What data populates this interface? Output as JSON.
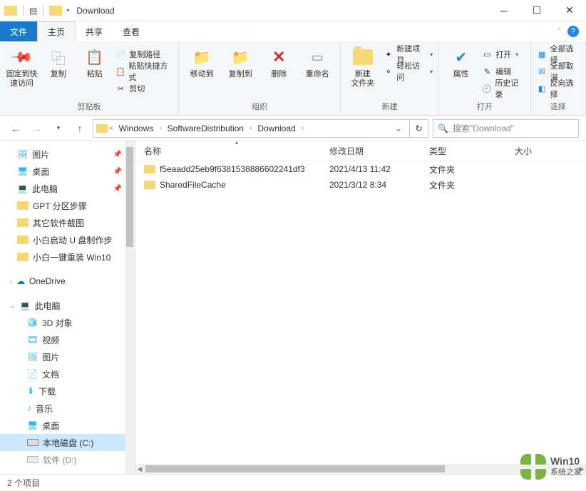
{
  "window": {
    "title": "Download"
  },
  "tabs": {
    "file": "文件",
    "home": "主页",
    "share": "共享",
    "view": "查看"
  },
  "ribbon": {
    "pin": "固定到快\n速访问",
    "copy": "复制",
    "paste": "粘贴",
    "copy_path": "复制路径",
    "paste_shortcut": "粘贴快捷方式",
    "cut": "剪切",
    "group_clipboard": "剪贴板",
    "move_to": "移动到",
    "copy_to": "复制到",
    "delete": "删除",
    "rename": "重命名",
    "group_organize": "组织",
    "new_folder": "新建\n文件夹",
    "new_item": "新建项目",
    "easy_access": "轻松访问",
    "group_new": "新建",
    "properties": "属性",
    "open": "打开",
    "edit": "编辑",
    "history": "历史记录",
    "group_open": "打开",
    "select_all": "全部选择",
    "select_none": "全部取消",
    "invert": "反向选择",
    "group_select": "选择"
  },
  "breadcrumb": [
    "Windows",
    "SoftwareDistribution",
    "Download"
  ],
  "search_placeholder": "搜索\"Download\"",
  "columns": {
    "name": "名称",
    "modified": "修改日期",
    "type": "类型",
    "size": "大小"
  },
  "files": [
    {
      "name": "f5eaadd25eb9f6381538886602241df3",
      "modified": "2021/4/13 11:42",
      "type": "文件夹"
    },
    {
      "name": "SharedFileCache",
      "modified": "2021/3/12 8:34",
      "type": "文件夹"
    }
  ],
  "sidebar": {
    "pictures": "图片",
    "desktop": "桌面",
    "this_pc_q": "此电脑",
    "gpt": "GPT 分区步骤",
    "other_screenshots": "其它软件截图",
    "xiaobai_usb": "小白启动 U 盘制作步",
    "xiaobai_reinstall": "小白一键重装 Win10",
    "onedrive": "OneDrive",
    "this_pc": "此电脑",
    "objects_3d": "3D 对象",
    "videos": "视频",
    "pictures2": "图片",
    "documents": "文档",
    "downloads": "下载",
    "music": "音乐",
    "desktop2": "桌面",
    "local_disk_c": "本地磁盘 (C:)",
    "soft_d": "软件 (D:)"
  },
  "status": "2 个项目",
  "watermark": {
    "line1": "Win10",
    "line2": "系统之家"
  }
}
